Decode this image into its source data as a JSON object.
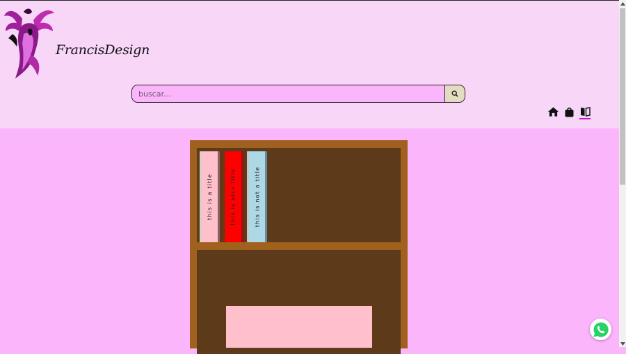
{
  "brand": {
    "name": "FrancisDesign",
    "logo_icon": "phoenix-logo"
  },
  "search": {
    "placeholder": "buscar...",
    "value": "",
    "button_icon": "search-icon"
  },
  "nav": [
    {
      "icon": "home-icon",
      "active": false
    },
    {
      "icon": "shopping-bag-icon",
      "active": false
    },
    {
      "icon": "book-open-icon",
      "active": true
    }
  ],
  "bookshelf": {
    "books": [
      {
        "title": "this is a title",
        "color": "#ffc0cb"
      },
      {
        "title": "this is also title",
        "color": "#ff0000"
      },
      {
        "title": "this is not a title",
        "color": "#add8e6"
      }
    ]
  },
  "colors": {
    "page_bg": "#fbb6fb",
    "header_bg": "#f7d6f7",
    "shelf_frame": "#a0601e",
    "shelf_inner": "#5c3a1a",
    "accent": "#c01ac0",
    "search_button_bg": "#e2dcc0"
  },
  "floating": {
    "chat_icon": "whatsapp-icon"
  }
}
